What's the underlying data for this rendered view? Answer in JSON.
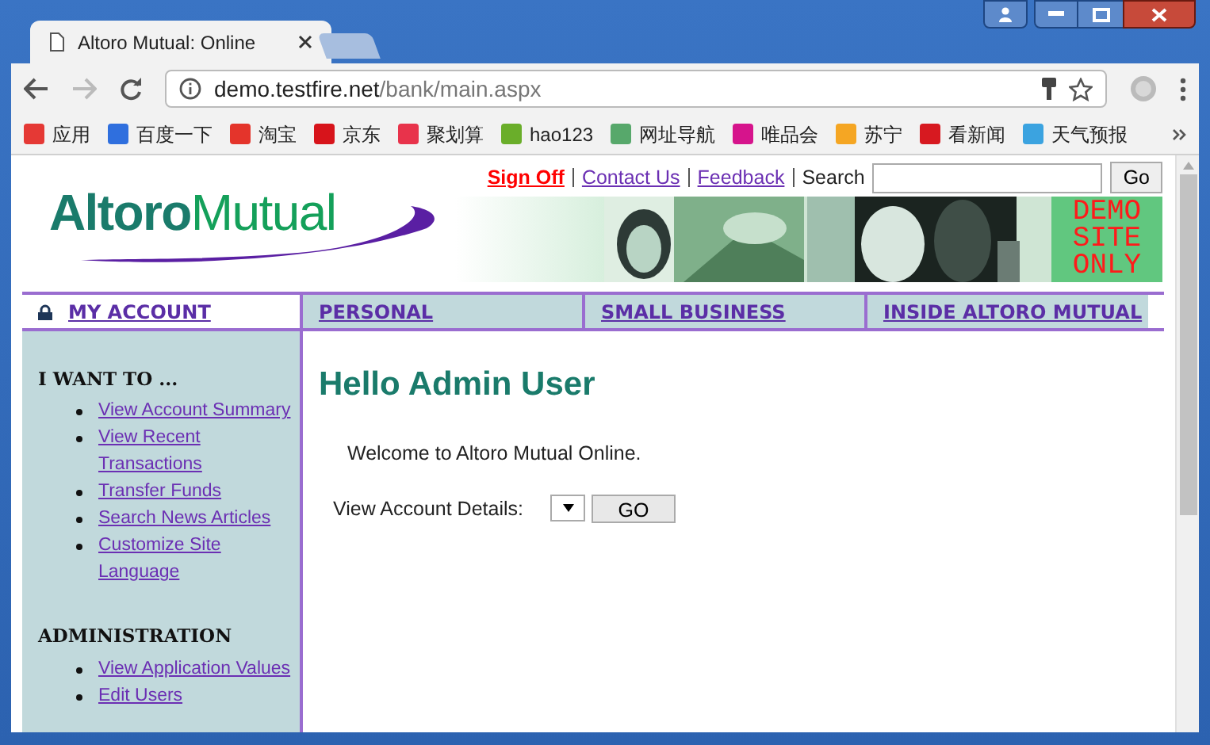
{
  "window": {
    "tab_title": "Altoro Mutual: Online"
  },
  "toolbar": {
    "host": "demo.testfire.net",
    "path": "/bank/main.aspx"
  },
  "bookmarks": [
    {
      "label": "应用",
      "color": "#e53935"
    },
    {
      "label": "百度一下",
      "color": "#2f6fde"
    },
    {
      "label": "淘宝",
      "color": "#e4342b"
    },
    {
      "label": "京东",
      "color": "#d7141b"
    },
    {
      "label": "聚划算",
      "color": "#e8334b"
    },
    {
      "label": "hao123",
      "color": "#6aae2a"
    },
    {
      "label": "网址导航",
      "color": "#57a86b"
    },
    {
      "label": "唯品会",
      "color": "#d6148c"
    },
    {
      "label": "苏宁",
      "color": "#f5a623"
    },
    {
      "label": "看新闻",
      "color": "#d71920"
    },
    {
      "label": "天气预报",
      "color": "#3ba3e0"
    }
  ],
  "header": {
    "logo": [
      "Altoro",
      "Mutual"
    ],
    "links": [
      {
        "label": "Sign Off",
        "kind": "alert"
      },
      {
        "label": "Contact Us",
        "kind": "link"
      },
      {
        "label": "Feedback",
        "kind": "link"
      }
    ],
    "search": {
      "label": "Search",
      "button": "Go"
    },
    "notice": [
      "DEMO",
      "SITE",
      "ONLY"
    ]
  },
  "nav": [
    {
      "label": "MY ACCOUNT",
      "selected": true
    },
    {
      "label": "PERSONAL",
      "selected": false
    },
    {
      "label": "SMALL BUSINESS",
      "selected": false
    },
    {
      "label": "INSIDE ALTORO MUTUAL",
      "selected": false
    }
  ],
  "sidebar": [
    {
      "heading": "I WANT TO ...",
      "items": [
        "View Account Summary",
        "View Recent Transactions",
        "Transfer Funds",
        "Search News Articles",
        "Customize Site Language"
      ]
    },
    {
      "heading": "ADMINISTRATION",
      "items": [
        "View Application Values",
        "Edit Users"
      ]
    }
  ],
  "content": {
    "heading": "Hello Admin User",
    "welcome": "Welcome to Altoro Mutual Online.",
    "account_label": "View Account Details:",
    "go_button": "GO"
  }
}
